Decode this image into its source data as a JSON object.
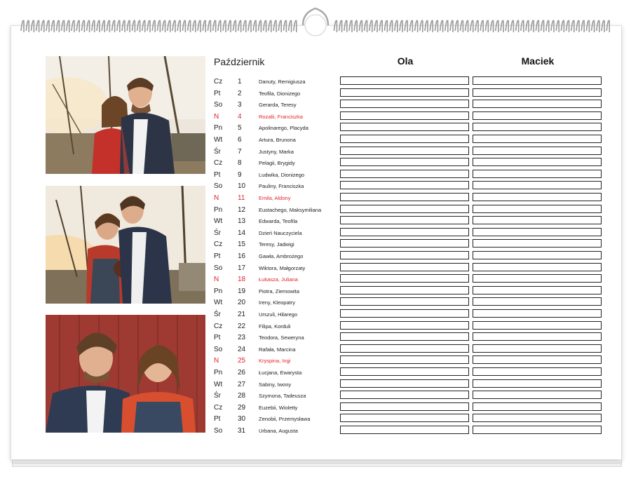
{
  "calendar": {
    "month": "Październik",
    "columns": [
      "Ola",
      "Maciek"
    ],
    "sunday_color": "#e3242b",
    "days": [
      {
        "dow": "Cz",
        "num": "1",
        "names": "Danuty, Remigiusza",
        "sunday": false
      },
      {
        "dow": "Pt",
        "num": "2",
        "names": "Teofila, Dionizego",
        "sunday": false
      },
      {
        "dow": "So",
        "num": "3",
        "names": "Gerarda, Teresy",
        "sunday": false
      },
      {
        "dow": "N",
        "num": "4",
        "names": "Rozalii, Franciszka",
        "sunday": true
      },
      {
        "dow": "Pn",
        "num": "5",
        "names": "Apolinarego, Placyda",
        "sunday": false
      },
      {
        "dow": "Wt",
        "num": "6",
        "names": "Artura, Brunona",
        "sunday": false
      },
      {
        "dow": "Śr",
        "num": "7",
        "names": "Justyny, Marka",
        "sunday": false
      },
      {
        "dow": "Cz",
        "num": "8",
        "names": "Pelagii, Brygidy",
        "sunday": false
      },
      {
        "dow": "Pt",
        "num": "9",
        "names": "Ludwika, Dionizego",
        "sunday": false
      },
      {
        "dow": "So",
        "num": "10",
        "names": "Pauliny, Franciszka",
        "sunday": false
      },
      {
        "dow": "N",
        "num": "11",
        "names": "Emila, Aldony",
        "sunday": true
      },
      {
        "dow": "Pn",
        "num": "12",
        "names": "Eustachego, Maksymiliana",
        "sunday": false
      },
      {
        "dow": "Wt",
        "num": "13",
        "names": "Edwarda, Teofila",
        "sunday": false
      },
      {
        "dow": "Śr",
        "num": "14",
        "names": "Dzień Nauczyciela",
        "sunday": false
      },
      {
        "dow": "Cz",
        "num": "15",
        "names": "Teresy, Jadwigi",
        "sunday": false
      },
      {
        "dow": "Pt",
        "num": "16",
        "names": "Gawła, Ambrożego",
        "sunday": false
      },
      {
        "dow": "So",
        "num": "17",
        "names": "Wiktora, Małgorzaty",
        "sunday": false
      },
      {
        "dow": "N",
        "num": "18",
        "names": "Łukasza, Juliana",
        "sunday": true
      },
      {
        "dow": "Pn",
        "num": "19",
        "names": "Piotra, Ziemowita",
        "sunday": false
      },
      {
        "dow": "Wt",
        "num": "20",
        "names": "Ireny, Kleopatry",
        "sunday": false
      },
      {
        "dow": "Śr",
        "num": "21",
        "names": "Urszuli, Hilarego",
        "sunday": false
      },
      {
        "dow": "Cz",
        "num": "22",
        "names": "Filipa, Korduli",
        "sunday": false
      },
      {
        "dow": "Pt",
        "num": "23",
        "names": "Teodora, Seweryna",
        "sunday": false
      },
      {
        "dow": "So",
        "num": "24",
        "names": "Rafała, Marcina",
        "sunday": false
      },
      {
        "dow": "N",
        "num": "25",
        "names": "Kryspina, Ingi",
        "sunday": true
      },
      {
        "dow": "Pn",
        "num": "26",
        "names": "Łucjana, Ewarysta",
        "sunday": false
      },
      {
        "dow": "Wt",
        "num": "27",
        "names": "Sabiny, Iwony",
        "sunday": false
      },
      {
        "dow": "Śr",
        "num": "28",
        "names": "Szymona, Tadeusza",
        "sunday": false
      },
      {
        "dow": "Cz",
        "num": "29",
        "names": "Euzebii, Wioletty",
        "sunday": false
      },
      {
        "dow": "Pt",
        "num": "30",
        "names": "Zenobii, Przemysława",
        "sunday": false
      },
      {
        "dow": "So",
        "num": "31",
        "names": "Urbana, Augusta",
        "sunday": false
      }
    ]
  },
  "photos": [
    {
      "name": "couple-embrace-photo",
      "palette": [
        "#e9e2d6",
        "#8a7a62",
        "#2c3446",
        "#b8322e"
      ]
    },
    {
      "name": "couple-kiss-farm-photo",
      "palette": [
        "#efe6d8",
        "#7d6f58",
        "#2b3448",
        "#b83a2a"
      ]
    },
    {
      "name": "couple-smiling-barn-photo",
      "palette": [
        "#9e3a32",
        "#7f2c27",
        "#2e3b52",
        "#d84f30"
      ]
    }
  ]
}
